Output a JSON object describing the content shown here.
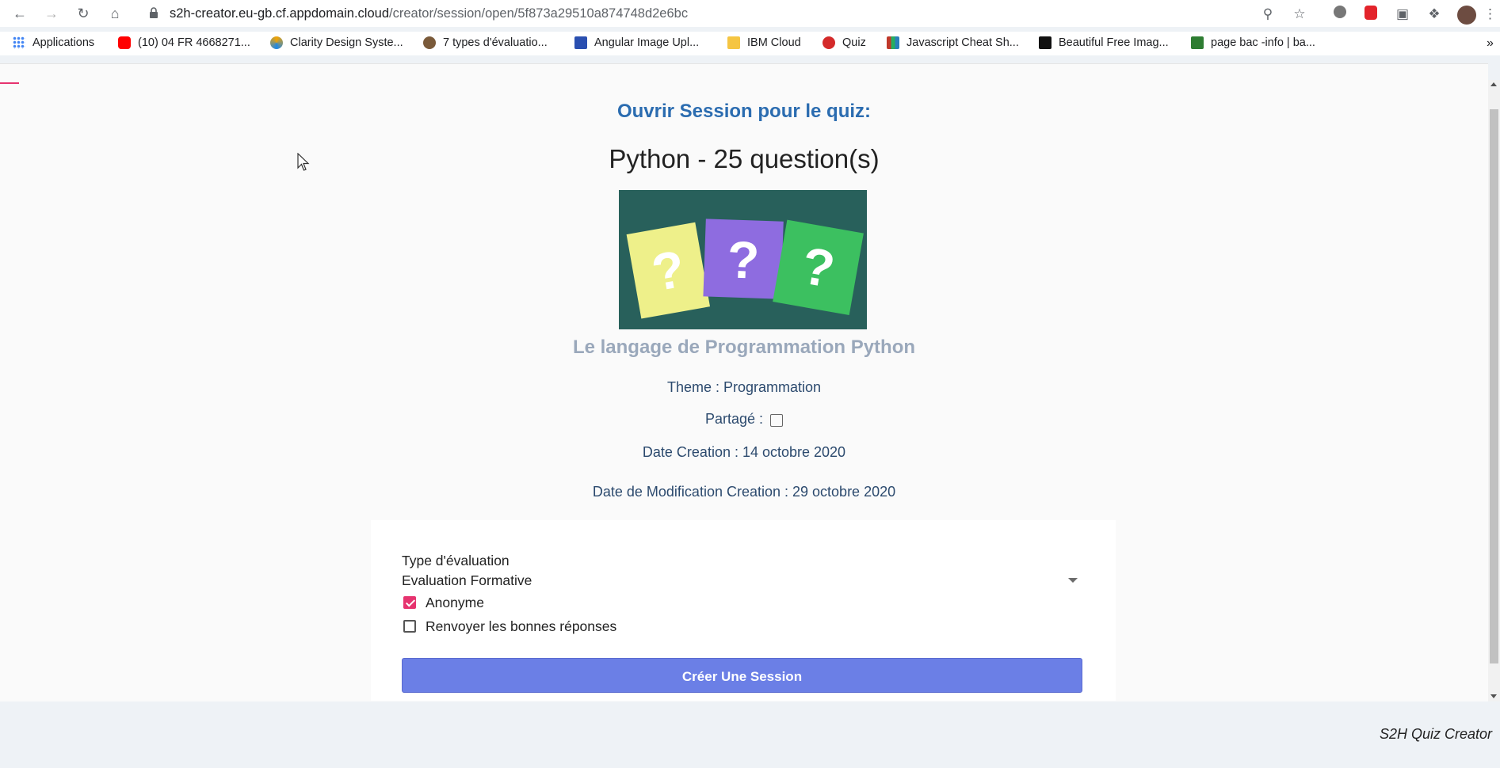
{
  "browser": {
    "url_host": "s2h-creator.eu-gb.cf.appdomain.cloud",
    "url_path": "/creator/session/open/5f873a29510a874748d2e6bc",
    "bookmarks": [
      {
        "label": "Applications",
        "icon": "apps-grid-icon",
        "color": "#4285f4"
      },
      {
        "label": "(10) 04 FR 4668271...",
        "icon": "youtube-icon",
        "color": "#ff0000"
      },
      {
        "label": "Clarity Design Syste...",
        "icon": "clarity-icon",
        "color": "#f4a300"
      },
      {
        "label": "7 types d'évaluatio...",
        "icon": "owl-icon",
        "color": "#7a5a3a"
      },
      {
        "label": "Angular Image Upl...",
        "icon": "angular-icon",
        "color": "#2a4fb0"
      },
      {
        "label": "IBM Cloud",
        "icon": "folder-icon",
        "color": "#f5c542"
      },
      {
        "label": "Quiz",
        "icon": "quiz-icon",
        "color": "#d42a2a"
      },
      {
        "label": "Javascript Cheat Sh...",
        "icon": "books-icon",
        "color": "#8b5a2b"
      },
      {
        "label": "Beautiful Free Imag...",
        "icon": "unsplash-icon",
        "color": "#111111"
      },
      {
        "label": "page bac -info | ba...",
        "icon": "bac-icon",
        "color": "#2e7d32"
      }
    ],
    "more_bookmarks": "»"
  },
  "page": {
    "heading": "Ouvrir Session pour le quiz:",
    "quiz_title": "Python - 25 question(s)",
    "subtitle": "Le langage de Programmation Python",
    "theme": "Theme : Programmation",
    "shared_label": "Partagé :",
    "shared_checked": false,
    "date_creation": "Date Creation : 14 octobre 2020",
    "date_modification": "Date de Modification Creation : 29 octobre 2020"
  },
  "form": {
    "evaluation_label": "Type d'évaluation",
    "evaluation_value": "Evaluation Formative",
    "anonymous_label": "Anonyme",
    "anonymous_checked": true,
    "return_answers_label": "Renvoyer les bonnes réponses",
    "return_answers_checked": false,
    "create_button": "Créer Une Session"
  },
  "footer": {
    "brand": "S2H Quiz Creator"
  },
  "colors": {
    "accent": "#e6336f",
    "heading": "#2b6cb0",
    "button": "#6b7fe6"
  }
}
